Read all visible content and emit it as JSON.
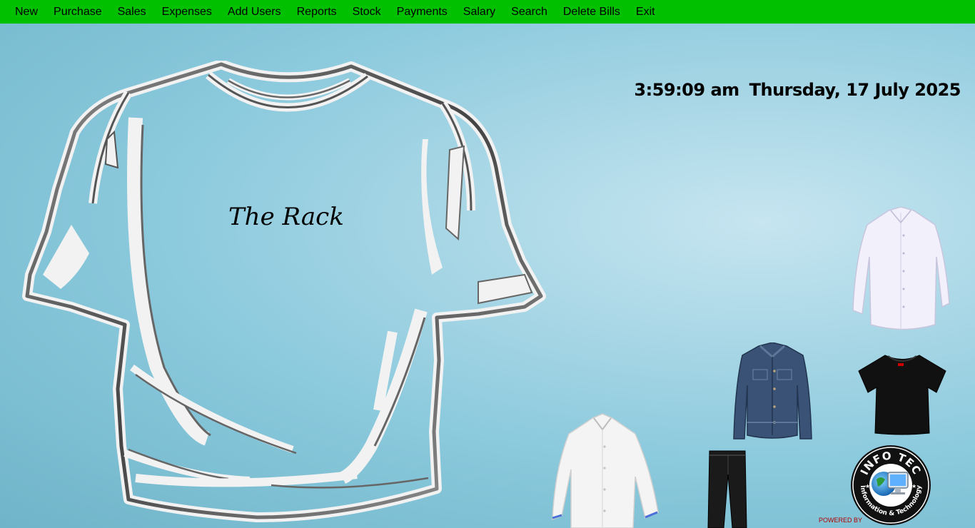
{
  "menu": {
    "items": [
      {
        "label": "New"
      },
      {
        "label": "Purchase"
      },
      {
        "label": "Sales"
      },
      {
        "label": "Expenses"
      },
      {
        "label": "Add Users"
      },
      {
        "label": "Reports"
      },
      {
        "label": "Stock"
      },
      {
        "label": "Payments"
      },
      {
        "label": "Salary"
      },
      {
        "label": "Search"
      },
      {
        "label": "Delete Bills"
      },
      {
        "label": "Exit"
      }
    ]
  },
  "clock": {
    "time": "3:59:09 am",
    "date": "Thursday, 17 July 2025"
  },
  "brand": {
    "name": "The Rack"
  },
  "products": [
    "white-shirt-icon",
    "denim-jacket-icon",
    "black-tshirt-icon",
    "white-dress-shirt-icon",
    "black-trousers-icon"
  ],
  "footer": {
    "powered_by": "POWERED BY",
    "logo_text_top": "INFO TEC",
    "logo_text_bottom": "Information & Technology"
  },
  "colors": {
    "menubar": "#00c000",
    "background": "#8ccadd",
    "powered_by": "#b00000"
  }
}
